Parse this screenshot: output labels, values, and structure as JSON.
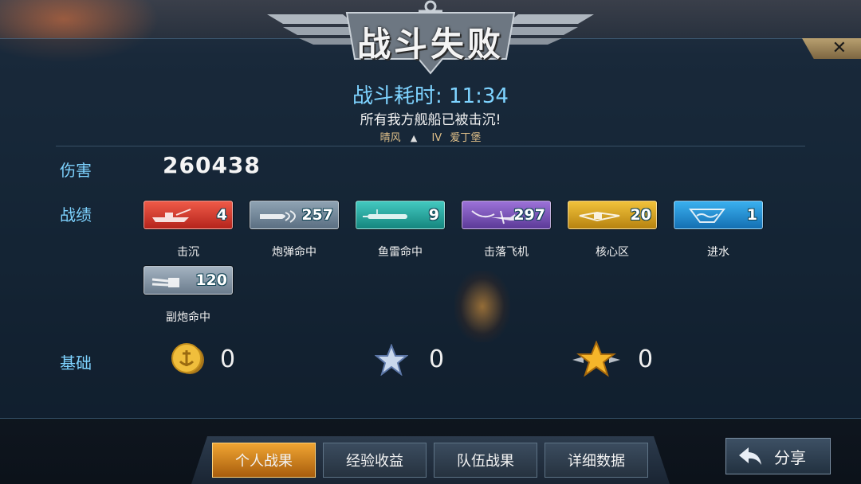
{
  "banner": {
    "title": "战斗失败"
  },
  "close": {
    "glyph": "✕"
  },
  "battle": {
    "duration": "战斗耗时: 11:34",
    "result_text": "所有我方舰船已被击沉!",
    "ship": {
      "player": "晴风",
      "tier": "IV",
      "name": "爱丁堡"
    }
  },
  "damage": {
    "label": "伤害",
    "value": "260438"
  },
  "record": {
    "label": "战绩",
    "items": [
      {
        "label": "击沉",
        "value": "4",
        "color": "#d8352a",
        "icon": "ship-sink-icon"
      },
      {
        "label": "炮弹命中",
        "value": "257",
        "color": "#6f8396",
        "icon": "shell-icon"
      },
      {
        "label": "鱼雷命中",
        "value": "9",
        "color": "#22a79e",
        "icon": "torpedo-icon"
      },
      {
        "label": "击落飞机",
        "value": "297",
        "color": "#7a53b6",
        "icon": "plane-icon"
      },
      {
        "label": "核心区",
        "value": "20",
        "color": "#d6a01f",
        "icon": "citadel-icon"
      },
      {
        "label": "进水",
        "value": "1",
        "color": "#2590d4",
        "icon": "flooding-icon"
      },
      {
        "label": "副炮命中",
        "value": "120",
        "color": "#8495a6",
        "icon": "secondary-gun-icon"
      }
    ]
  },
  "basic": {
    "label": "基础",
    "coins": "0",
    "silver_star": "0",
    "gold_star": "0"
  },
  "tabs": [
    {
      "label": "个人战果",
      "active": true
    },
    {
      "label": "经验收益",
      "active": false
    },
    {
      "label": "队伍战果",
      "active": false
    },
    {
      "label": "详细数据",
      "active": false
    }
  ],
  "share": {
    "label": "分享"
  }
}
